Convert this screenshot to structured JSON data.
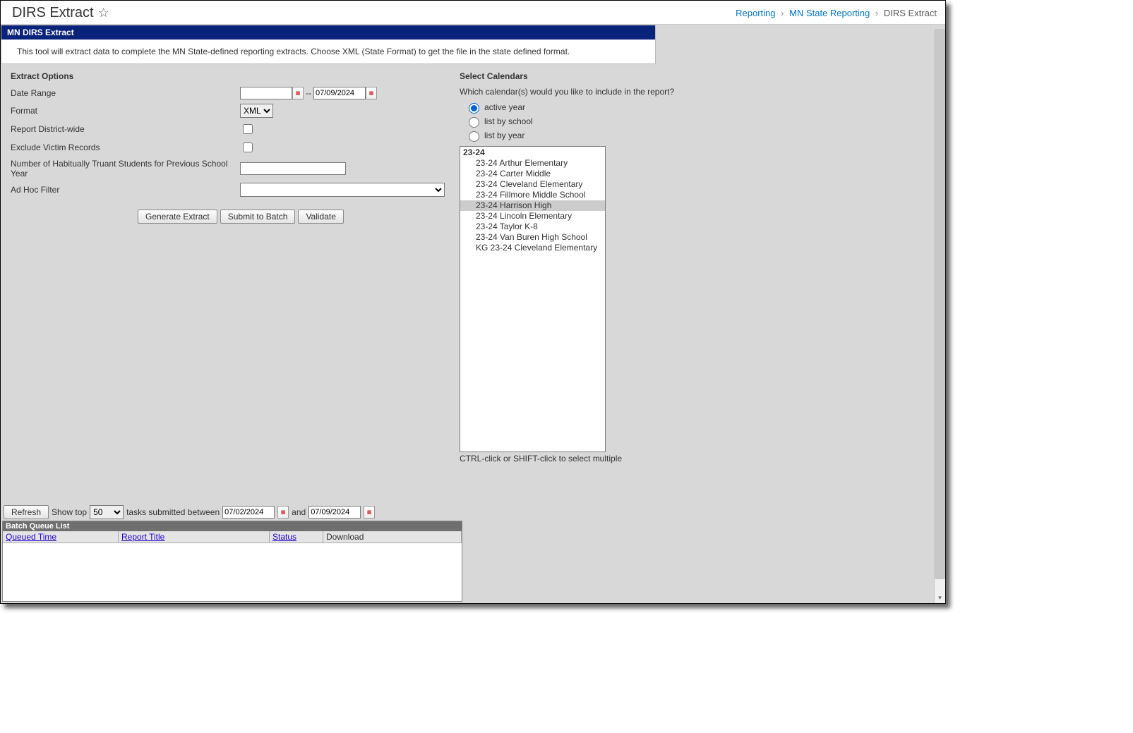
{
  "header": {
    "title": "DIRS Extract",
    "breadcrumb": {
      "reporting": "Reporting",
      "state": "MN State Reporting",
      "current": "DIRS Extract"
    }
  },
  "tool": {
    "bar_title": "MN DIRS Extract",
    "description": "This tool will extract data to complete the MN State-defined reporting extracts. Choose XML (State Format) to get the file in the state defined format."
  },
  "options": {
    "section_title": "Extract Options",
    "date_range": {
      "label": "Date Range",
      "start": "",
      "sep": "--",
      "end": "07/09/2024"
    },
    "format": {
      "label": "Format",
      "value": "XML",
      "options": [
        "XML"
      ]
    },
    "district_wide": {
      "label": "Report District-wide",
      "checked": false
    },
    "exclude_victim": {
      "label": "Exclude Victim Records",
      "checked": false
    },
    "truant": {
      "label": "Number of Habitually Truant Students for Previous School Year",
      "value": ""
    },
    "adhoc": {
      "label": "Ad Hoc Filter",
      "value": ""
    },
    "buttons": {
      "generate": "Generate Extract",
      "submit_batch": "Submit to Batch",
      "validate": "Validate"
    }
  },
  "calendars": {
    "section_title": "Select Calendars",
    "question": "Which calendar(s) would you like to include in the report?",
    "radios": {
      "active": "active year",
      "by_school": "list by school",
      "by_year": "list by year"
    },
    "selected_radio": "active",
    "group": "23-24",
    "items": [
      "23-24 Arthur Elementary",
      "23-24 Carter Middle",
      "23-24 Cleveland Elementary",
      "23-24 Fillmore Middle School",
      "23-24 Harrison High",
      "23-24 Lincoln Elementary",
      "23-24 Taylor K-8",
      "23-24 Van Buren High School",
      "KG 23-24 Cleveland Elementary"
    ],
    "selected_index": 4,
    "hint": "CTRL-click or SHIFT-click to select multiple"
  },
  "batch": {
    "refresh": "Refresh",
    "show_top_label": "Show top",
    "show_top_value": "50",
    "tasks_between": "tasks submitted between",
    "date1": "07/02/2024",
    "and": "and",
    "date2": "07/09/2024",
    "title": "Batch Queue List",
    "headers": {
      "queued": "Queued Time",
      "report": "Report Title",
      "status": "Status",
      "download": "Download"
    }
  }
}
